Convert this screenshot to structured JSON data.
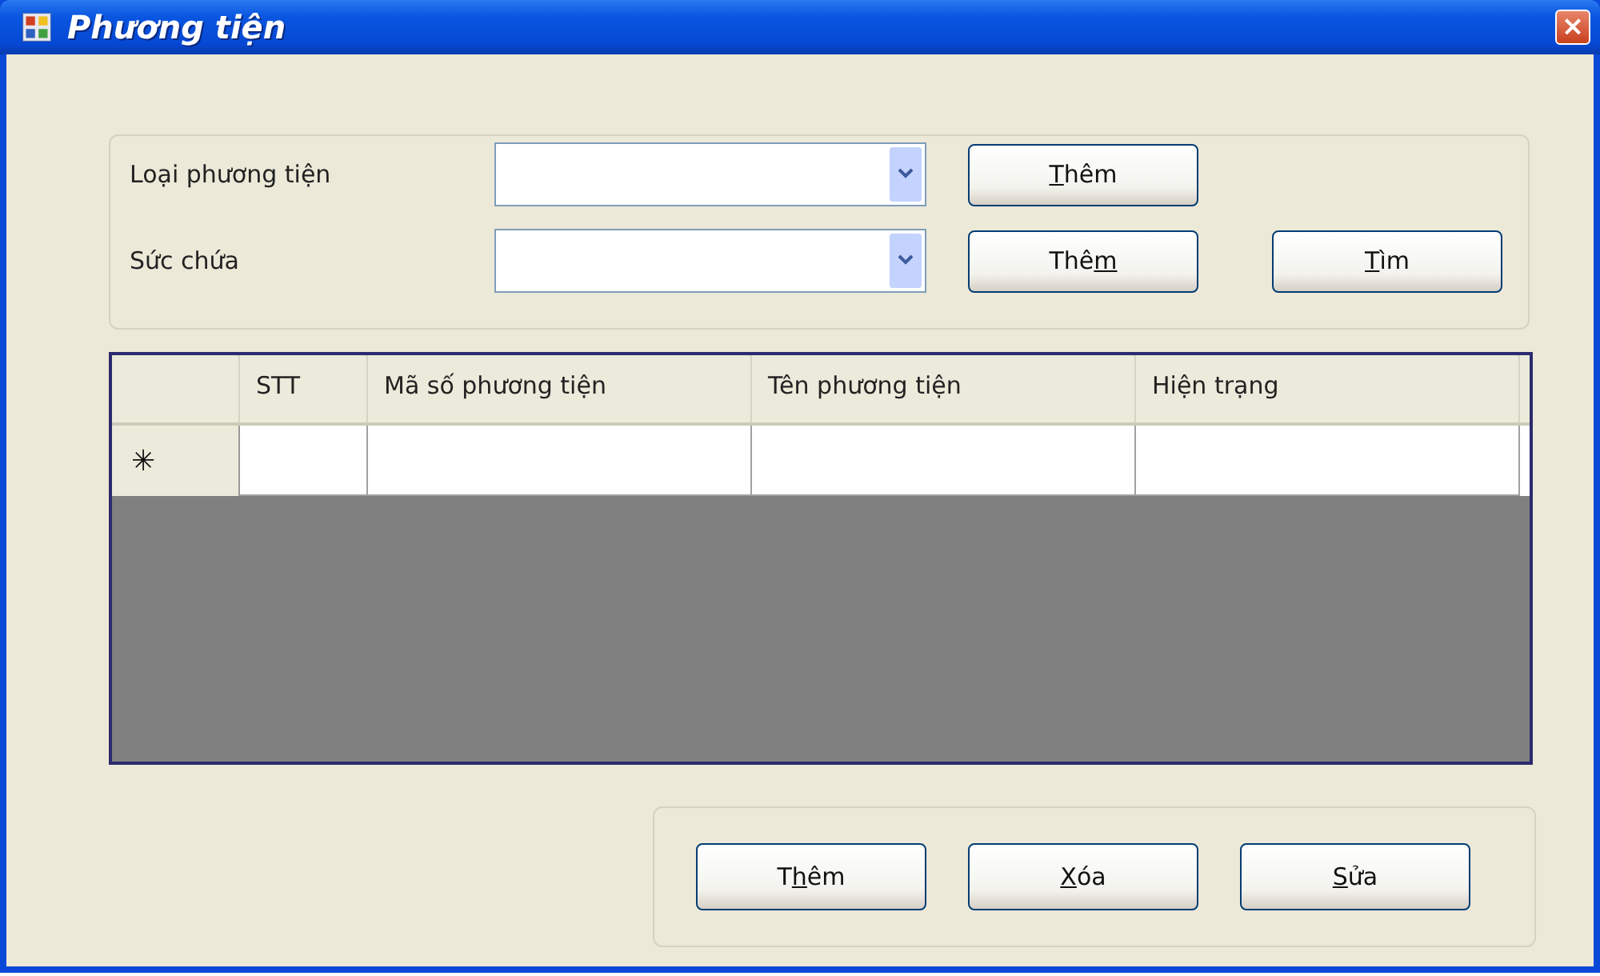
{
  "window": {
    "title": "Phương tiện",
    "close": "×"
  },
  "filters": [
    {
      "label": "Loại phương tiện",
      "button": {
        "mnemonic": "T",
        "after": "hêm"
      }
    },
    {
      "label": "Sức chứa",
      "button": {
        "before": "Thê",
        "mnemonic": "m"
      }
    }
  ],
  "search_button": {
    "mnemonic": "T",
    "after": "ìm"
  },
  "table": {
    "columns": [
      "STT",
      "Mã số phương tiện",
      "Tên phương tiện",
      "Hiện trạng"
    ],
    "new_row_marker": "✳"
  },
  "actions": [
    {
      "before": "T",
      "mnemonic": "h",
      "after": "êm"
    },
    {
      "mnemonic": "X",
      "after": "óa"
    },
    {
      "mnemonic": "S",
      "after": "ửa"
    }
  ]
}
